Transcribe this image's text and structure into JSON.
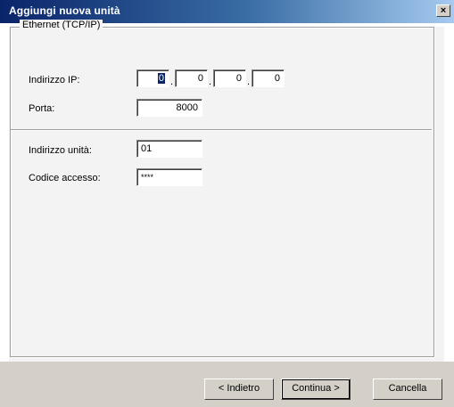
{
  "window": {
    "title": "Aggiungi nuova unità",
    "close_glyph": "×"
  },
  "group": {
    "legend": "Ethernet (TCP/IP)",
    "ip_label": "Indirizzo IP:",
    "ip_octets": [
      "0",
      "0",
      "0",
      "0"
    ],
    "port_label": "Porta:",
    "port_value": "8000"
  },
  "unit": {
    "address_label": "Indirizzo unità:",
    "address_value": "01",
    "code_label": "Codice accesso:",
    "code_value": "****"
  },
  "buttons": {
    "back": "< Indietro",
    "next": "Continua >",
    "cancel": "Cancella"
  },
  "colors": {
    "title_start": "#0a246a",
    "title_end": "#a6caf0",
    "face": "#d4d0c8"
  }
}
